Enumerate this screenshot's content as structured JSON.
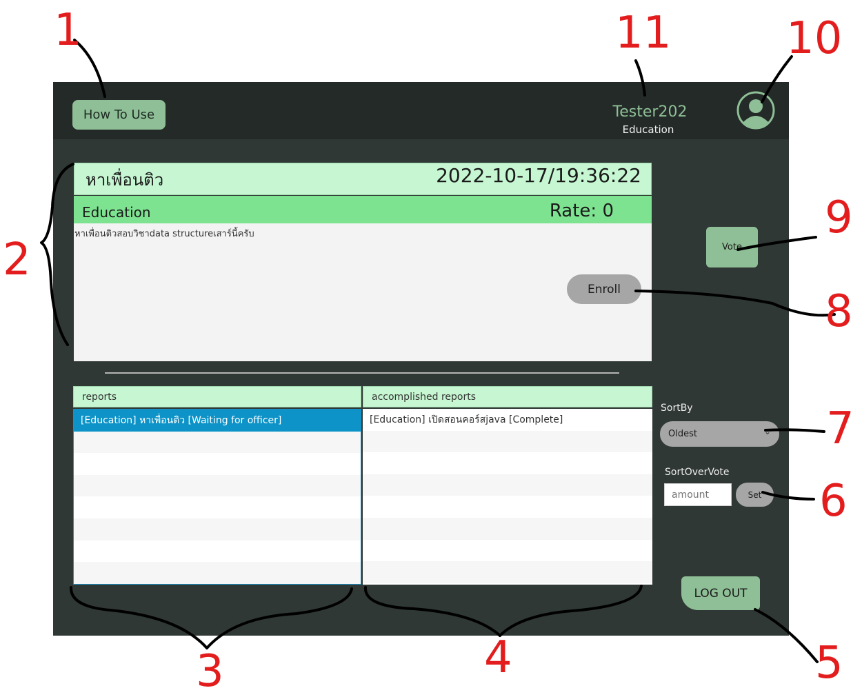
{
  "topbar": {
    "how_to_use": "How To Use",
    "username": "Tester202",
    "user_category": "Education"
  },
  "post": {
    "title": "หาเพื่อนติว",
    "datetime": "2022-10-17/19:36:22",
    "category": "Education",
    "rate": "Rate: 0",
    "description": "หาเพื่อนติวสอบวิชาdata structureเสาร์นี้ครับ",
    "enroll_label": "Enroll"
  },
  "vote_label": "Vote",
  "reports": {
    "header": "reports",
    "items": [
      "[Education] หาเพื่อนติว [Waiting for officer]"
    ]
  },
  "accomplished": {
    "header": "accomplished reports",
    "items": [
      "[Education] เปิดสอนคอร์สjava [Complete]"
    ]
  },
  "sort": {
    "label": "SortBy",
    "selected": "Oldest"
  },
  "sort_over_vote": {
    "label": "SortOverVote",
    "placeholder": "amount",
    "set_label": "Set"
  },
  "logout_label": "LOG OUT",
  "annotations": [
    "1",
    "2",
    "3",
    "4",
    "5",
    "6",
    "7",
    "8",
    "9",
    "10",
    "11"
  ],
  "colors": {
    "window_bg": "#2f3835",
    "topbar_bg": "#232a28",
    "accent_green": "#8fbf96",
    "header_mint": "#c6f7d2",
    "subheader_green": "#7ee391",
    "selection_blue": "#0d93c7",
    "annotation_red": "#e31d1d"
  }
}
